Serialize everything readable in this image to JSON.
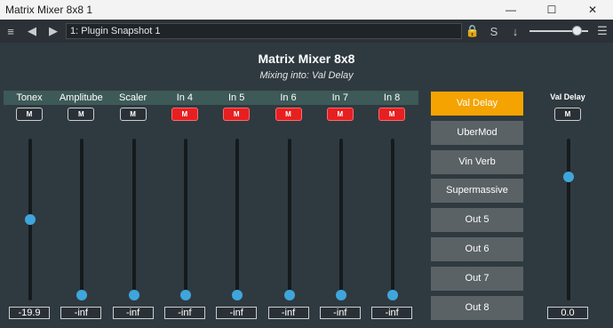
{
  "window": {
    "title": "Matrix Mixer 8x8 1",
    "minimize_glyph": "—",
    "maximize_glyph": "☐",
    "close_glyph": "✕"
  },
  "toolbar": {
    "snapshot_value": "1: Plugin Snapshot 1",
    "settings_icon_glyph": "≡",
    "prev_glyph": "◀",
    "next_glyph": "▶",
    "lock_glyph": "🔒",
    "s_glyph": "S",
    "pin_glyph": "↓",
    "menu_glyph": "☰",
    "slider_level": 0.8
  },
  "panel": {
    "title": "Matrix Mixer 8x8",
    "subtitle": "Mixing into: Val Delay"
  },
  "channels": [
    {
      "label": "Tonex",
      "mute": "M",
      "muted": false,
      "value": "-19.9",
      "level": 0.5
    },
    {
      "label": "Amplitube",
      "mute": "M",
      "muted": false,
      "value": "-inf",
      "level": 0.0
    },
    {
      "label": "Scaler",
      "mute": "M",
      "muted": false,
      "value": "-inf",
      "level": 0.0
    },
    {
      "label": "In 4",
      "mute": "M",
      "muted": true,
      "value": "-inf",
      "level": 0.0
    },
    {
      "label": "In 5",
      "mute": "M",
      "muted": true,
      "value": "-inf",
      "level": 0.0
    },
    {
      "label": "In 6",
      "mute": "M",
      "muted": true,
      "value": "-inf",
      "level": 0.0
    },
    {
      "label": "In 7",
      "mute": "M",
      "muted": true,
      "value": "-inf",
      "level": 0.0
    },
    {
      "label": "In 8",
      "mute": "M",
      "muted": true,
      "value": "-inf",
      "level": 0.0
    }
  ],
  "destinations": [
    {
      "label": "Val Delay",
      "active": true
    },
    {
      "label": "UberMod",
      "active": false
    },
    {
      "label": "Vin Verb",
      "active": false
    },
    {
      "label": "Supermassive",
      "active": false
    },
    {
      "label": "Out 5",
      "active": false
    },
    {
      "label": "Out 6",
      "active": false
    },
    {
      "label": "Out 7",
      "active": false
    },
    {
      "label": "Out 8",
      "active": false
    }
  ],
  "master": {
    "label": "Val Delay",
    "mute": "M",
    "value": "0.0",
    "level": 0.78
  },
  "colors": {
    "accent": "#f4a300",
    "mute_on": "#e62020",
    "thumb": "#3fa6dc"
  }
}
